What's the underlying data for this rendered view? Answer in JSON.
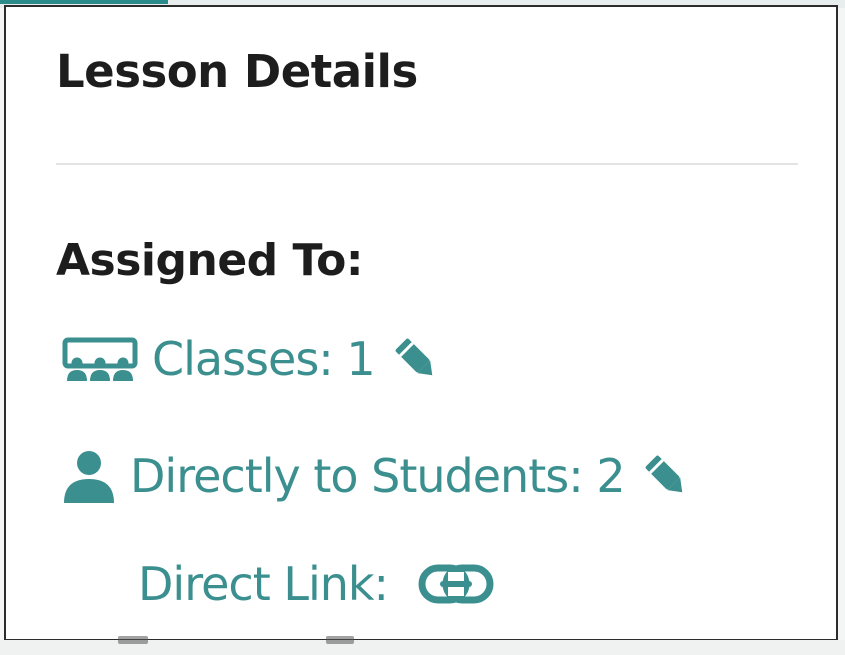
{
  "panel": {
    "title": "Lesson Details"
  },
  "assigned": {
    "heading": "Assigned To:",
    "classes": {
      "label": "Classes: 1",
      "icon": "classroom-icon",
      "edit_icon": "pencil-icon"
    },
    "students": {
      "label": "Directly to Students: 2",
      "icon": "user-icon",
      "edit_icon": "pencil-icon"
    },
    "direct_link": {
      "label": "Direct Link:",
      "icon": "link-icon"
    }
  },
  "colors": {
    "accent": "#3c8f8f",
    "text": "#1d1d1d",
    "divider": "#e3e3e3",
    "border": "#2c2c2c"
  }
}
